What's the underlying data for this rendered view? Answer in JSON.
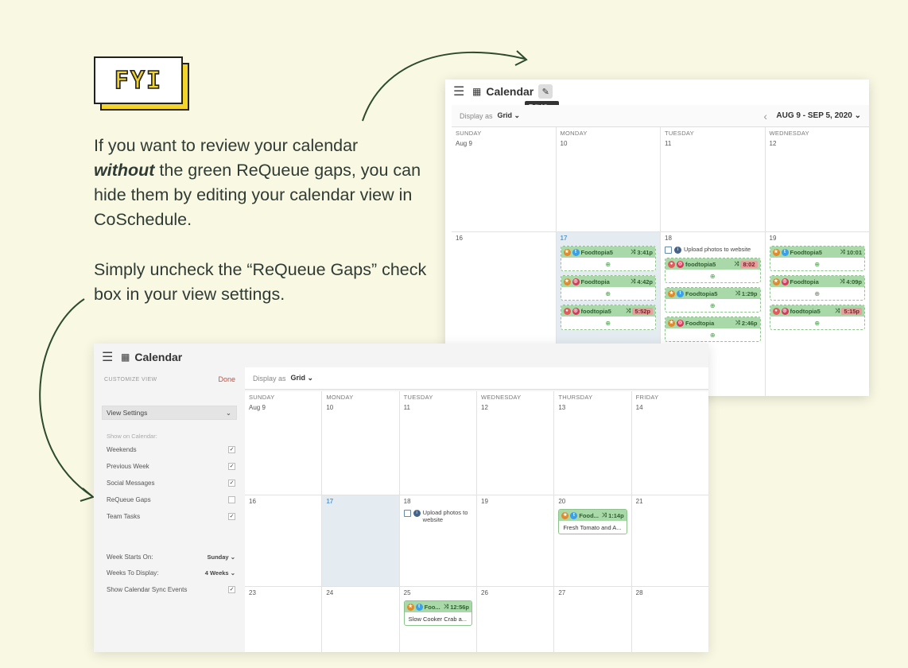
{
  "badge": {
    "text": "FYI"
  },
  "text": {
    "p1_a": "If you want to review your calendar",
    "p1_em": "without",
    "p1_b": " the green ReQueue gaps, you can hide them by editing your calendar view in CoSchedule.",
    "p2": "Simply uncheck the “ReQueue Gaps” check box in your view settings."
  },
  "colors": {
    "background": "#f8f8e3",
    "badge_yellow": "#f2d42a",
    "gap_green": "#a9d8a9",
    "done_red": "#d6483a"
  },
  "topWindow": {
    "title": "Calendar",
    "tooltip": "Edit View",
    "displayAs": "Display as",
    "displayValue": "Grid",
    "range": "AUG 9 - SEP 5, 2020",
    "days": [
      "SUNDAY",
      "MONDAY",
      "TUESDAY",
      "WEDNESDAY"
    ],
    "week1": [
      "Aug 9",
      "10",
      "11",
      "12"
    ],
    "week2": [
      "16",
      "17",
      "18",
      "19"
    ],
    "posts": {
      "mon": [
        {
          "name": "Foodtopia5",
          "time": "3:41p"
        },
        {
          "name": "Foodtopia",
          "time": "4:42p"
        },
        {
          "name": "foodtopia5",
          "time": "5:52p"
        }
      ],
      "tue_task": "Upload photos to website",
      "tue": [
        {
          "name": "foodtopia5",
          "time": "8:02"
        },
        {
          "name": "Foodtopia5",
          "time": "1:29p"
        },
        {
          "name": "Foodtopia",
          "time": "2:46p"
        }
      ],
      "wed": [
        {
          "name": "Foodtopia5",
          "time": "10:01"
        },
        {
          "name": "Foodtopia",
          "time": "4:09p"
        },
        {
          "name": "foodtopia5",
          "time": "5:15p"
        }
      ]
    }
  },
  "bottomWindow": {
    "title": "Calendar",
    "customize": "CUSTOMIZE VIEW",
    "done": "Done",
    "viewSettings": "View Settings",
    "showOn": "Show on Calendar:",
    "options": [
      {
        "label": "Weekends",
        "checked": "✓"
      },
      {
        "label": "Previous Week",
        "checked": "✓"
      },
      {
        "label": "Social Messages",
        "checked": "✓"
      },
      {
        "label": "ReQueue Gaps",
        "checked": ""
      },
      {
        "label": "Team Tasks",
        "checked": "✓"
      }
    ],
    "weekStarts": {
      "label": "Week Starts On:",
      "value": "Sunday"
    },
    "weeksDisplay": {
      "label": "Weeks To Display:",
      "value": "4 Weeks"
    },
    "syncEvents": {
      "label": "Show Calendar Sync Events",
      "checked": "✓"
    },
    "displayAs": "Display as",
    "displayValue": "Grid",
    "days": [
      "SUNDAY",
      "MONDAY",
      "TUESDAY",
      "WEDNESDAY",
      "THURSDAY",
      "FRIDAY"
    ],
    "week1": [
      "Aug 9",
      "10",
      "11",
      "12",
      "13",
      "14"
    ],
    "week2": [
      "16",
      "17",
      "18",
      "19",
      "20",
      "21"
    ],
    "week3": [
      "23",
      "24",
      "25",
      "26",
      "27",
      "28"
    ],
    "task": "Upload photos to website",
    "post20": {
      "name": "Food...",
      "time": "1:14p",
      "body": "Fresh Tomato and A..."
    },
    "post25": {
      "name": "Foo...",
      "time": "12:56p",
      "body": "Slow Cooker Crab a..."
    }
  }
}
